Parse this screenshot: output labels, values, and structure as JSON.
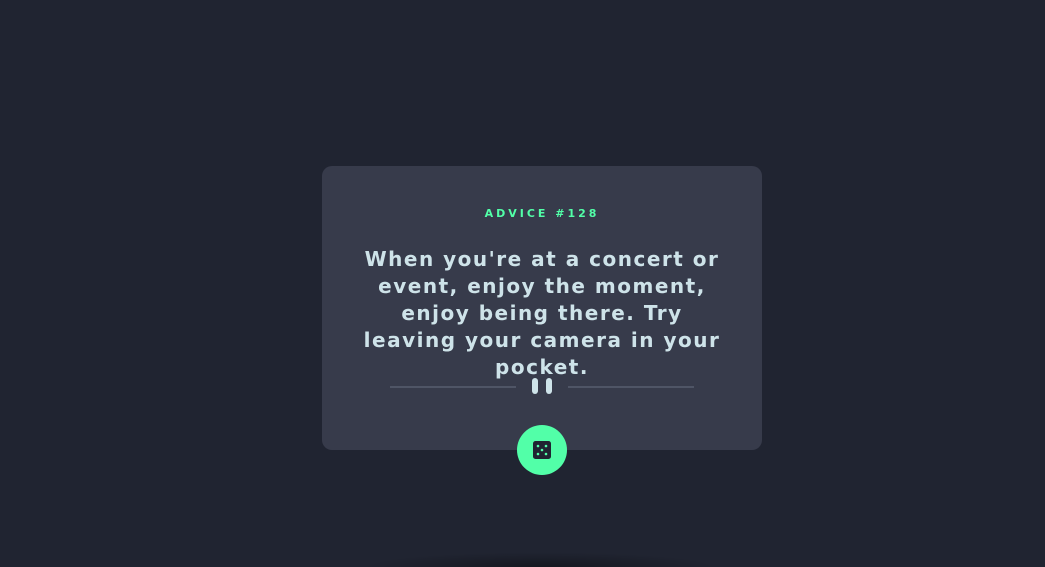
{
  "card": {
    "advice_label": "ADVICE #128",
    "quote": "When you're at a concert or event, enjoy the moment, enjoy being there. Try leaving your camera in your pocket."
  },
  "icons": {
    "divider": "pause-icon",
    "button": "dice-icon"
  },
  "colors": {
    "background": "#202431",
    "card": "#373b4b",
    "accent": "#52ffa8",
    "text": "#cee3e9",
    "divider": "#4f5566"
  }
}
